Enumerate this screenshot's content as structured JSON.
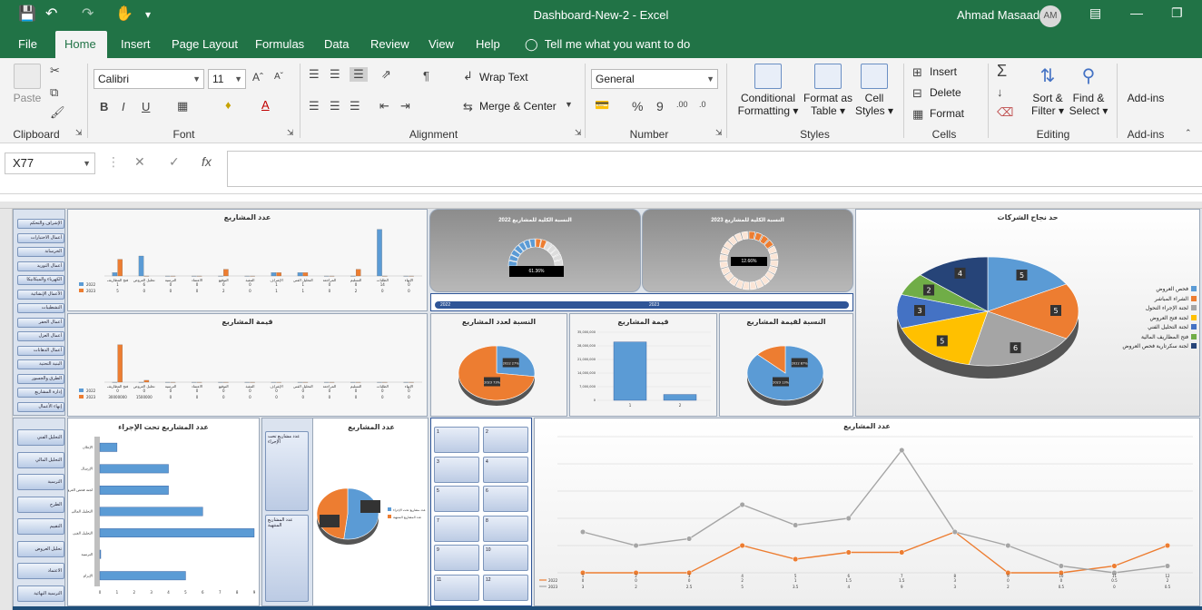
{
  "window": {
    "title": "Dashboard-New-2  -  Excel",
    "user": "Ahmad Masaad",
    "avatar_initials": "AM"
  },
  "tabs": [
    {
      "label": "File"
    },
    {
      "label": "Home"
    },
    {
      "label": "Insert"
    },
    {
      "label": "Page Layout"
    },
    {
      "label": "Formulas"
    },
    {
      "label": "Data"
    },
    {
      "label": "Review"
    },
    {
      "label": "View"
    },
    {
      "label": "Help"
    }
  ],
  "tell_me": "Tell me what you want to do",
  "ribbon": {
    "clipboard": {
      "paste": "Paste",
      "label": "Clipboard"
    },
    "font": {
      "name": "Calibri",
      "size": "11",
      "bold": "B",
      "italic": "I",
      "underline": "U",
      "label": "Font"
    },
    "alignment": {
      "wrap_text": "Wrap Text",
      "merge_center": "Merge & Center",
      "label": "Alignment"
    },
    "number": {
      "format": "General",
      "percent": "%",
      "comma": "9",
      "label": "Number"
    },
    "styles": {
      "conditional_1": "Conditional",
      "conditional_2": "Formatting",
      "format_table_1": "Format as",
      "format_table_2": "Table",
      "cell_styles_1": "Cell",
      "cell_styles_2": "Styles",
      "label": "Styles"
    },
    "cells": {
      "insert": "Insert",
      "delete": "Delete",
      "format": "Format",
      "label": "Cells"
    },
    "editing": {
      "sort_1": "Sort &",
      "sort_2": "Filter",
      "find_1": "Find &",
      "find_2": "Select",
      "label": "Editing"
    },
    "addins": {
      "btn": "Add-ins",
      "label": "Add-ins"
    }
  },
  "formula_bar": {
    "name_box": "X77",
    "fx": "fx",
    "cancel": "✕",
    "enter": "✓"
  },
  "dashboard": {
    "nav_items": [
      "الإشراف والتحكم الهندسي",
      "أعمال الاختبارات",
      "الخرسانة",
      "أعمال التوريد",
      "الكهرباء والميكانيكا",
      "الأعمال الإنشائية",
      "التشطيبات",
      "أعمال الحفر",
      "أعمال العزل",
      "أعمال الدهانات",
      "البنية التحتية",
      "الطرق والجسور",
      "إدارة المشاريع",
      "إنهاء الأعمال"
    ],
    "nav_items_2": [
      "التحليل الفني",
      "التحليل المالي",
      "الترسية",
      "الطرح",
      "التقييم",
      "تحليل العروض",
      "الاعتماد",
      "الترسية النهائية"
    ],
    "slicer_numbers": [
      "1",
      "2",
      "3",
      "4",
      "5",
      "6",
      "7",
      "8",
      "9",
      "10",
      "11",
      "12"
    ],
    "gauge_1": {
      "title": "النسبة الكلية للمشاريع 2022",
      "value": "61.36%"
    },
    "gauge_2": {
      "title": "النسبة الكلية للمشاريع 2023",
      "value": "12.66%"
    },
    "year_labels": [
      "2022",
      "2023"
    ]
  },
  "chart_data": [
    {
      "type": "bar",
      "title": "عدد المشاريع",
      "categories": [
        "فتح المظاريف",
        "تحليل العروض",
        "الترسية",
        "الاعتماد",
        "التوقيع",
        "التنفيذ",
        "الإشراف",
        "التحليل الفني",
        "المراجعة",
        "التسليم",
        "الطلبات",
        "الإنهاء"
      ],
      "series": [
        {
          "name": "2022",
          "values": [
            1,
            6,
            0,
            0,
            0,
            0,
            1,
            1,
            0,
            0,
            14,
            0
          ]
        },
        {
          "name": "2023",
          "values": [
            5,
            0,
            0,
            0,
            2,
            0,
            1,
            1,
            0,
            2,
            0,
            0
          ]
        }
      ],
      "ylim": [
        0,
        15
      ]
    },
    {
      "type": "bar",
      "title": "قيمة المشاريع",
      "categories": [
        "فتح المظاريف",
        "تحليل العروض",
        "الترسية",
        "الاعتماد",
        "التوقيع",
        "التنفيذ",
        "الإشراف",
        "التحليل الفني",
        "المراجعة",
        "التسليم",
        "الطلبات",
        "الإنهاء"
      ],
      "series": [
        {
          "name": "2022",
          "values": [
            0,
            0,
            0,
            0,
            0,
            0,
            0,
            0,
            0,
            0,
            0,
            0
          ]
        },
        {
          "name": "2023",
          "values": [
            30000000,
            1500000,
            0,
            0,
            0,
            0,
            0,
            0,
            0,
            0,
            0,
            0
          ]
        }
      ],
      "ylim": [
        0,
        40000000
      ]
    },
    {
      "type": "pie",
      "title": "حد نجاح الشركات",
      "slices": [
        {
          "label": "فحص العروض",
          "value": 5,
          "color": "#5b9bd5"
        },
        {
          "label": "الشراء المباشر",
          "value": 5,
          "color": "#ed7d31"
        },
        {
          "label": "لجنة الإجراء التحول",
          "value": 6,
          "color": "#a5a5a5"
        },
        {
          "label": "لجنة فتح العروض",
          "value": 5,
          "color": "#ffc000"
        },
        {
          "label": "لجنة التحليل الفني",
          "value": 3,
          "color": "#4472c4"
        },
        {
          "label": "فتح المظاريف المالية",
          "value": 2,
          "color": "#70ad47"
        },
        {
          "label": "لجنة سكرتارية فحص العروض",
          "value": 4,
          "color": "#264478"
        }
      ]
    },
    {
      "type": "pie",
      "title": "النسبة لعدد المشاريع",
      "slices": [
        {
          "label": "2022",
          "value": 27,
          "color": "#5b9bd5",
          "text": "2022 27%"
        },
        {
          "label": "2023",
          "value": 73,
          "color": "#ed7d31",
          "text": "2023 73%"
        }
      ]
    },
    {
      "type": "bar",
      "title": "قيمة المشاريع",
      "categories": [
        "1",
        "2"
      ],
      "values": [
        30000000,
        3000000
      ],
      "ylim": [
        0,
        35000000
      ]
    },
    {
      "type": "pie",
      "title": "النسبة لقيمة المشاريع",
      "slices": [
        {
          "label": "2022",
          "value": 87,
          "color": "#5b9bd5",
          "text": "2022 87%"
        },
        {
          "label": "2023",
          "value": 13,
          "color": "#ed7d31",
          "text": "2023 13%"
        }
      ]
    },
    {
      "type": "bar",
      "title": "عدد المشاريع تحت الإجراء",
      "categories": [
        "الإعلان",
        "الإرسال",
        "لجنة فحص العروض",
        "التحليل المالي",
        "التحليل الفني",
        "الترسية",
        "الإبرام"
      ],
      "values": [
        1,
        4,
        4,
        6,
        9,
        0,
        5
      ],
      "ylim": [
        0,
        9
      ]
    },
    {
      "type": "pie",
      "title": "عدد المشاريع",
      "slices": [
        {
          "label": "عدد مشاريع تحت الإجراء",
          "value": 52,
          "color": "#5b9bd5"
        },
        {
          "label": "عدد المشاريع المنتهية",
          "value": 48,
          "color": "#ed7d31"
        }
      ]
    },
    {
      "type": "line",
      "title": "عدد المشاريع",
      "categories": [
        "1",
        "2",
        "3",
        "4",
        "5",
        "6",
        "7",
        "8",
        "9",
        "10",
        "11",
        "12"
      ],
      "series": [
        {
          "name": "2022",
          "values": [
            0,
            0,
            0,
            2,
            1,
            1.5,
            1.5,
            3,
            0,
            0,
            0.5,
            2
          ],
          "color": "#ed7d31"
        },
        {
          "name": "2023",
          "values": [
            3,
            2,
            2.5,
            5,
            3.5,
            4,
            9,
            3,
            2,
            0.5,
            0,
            0.5
          ],
          "color": "#a5a5a5"
        }
      ],
      "ylim": [
        0,
        10
      ]
    }
  ]
}
